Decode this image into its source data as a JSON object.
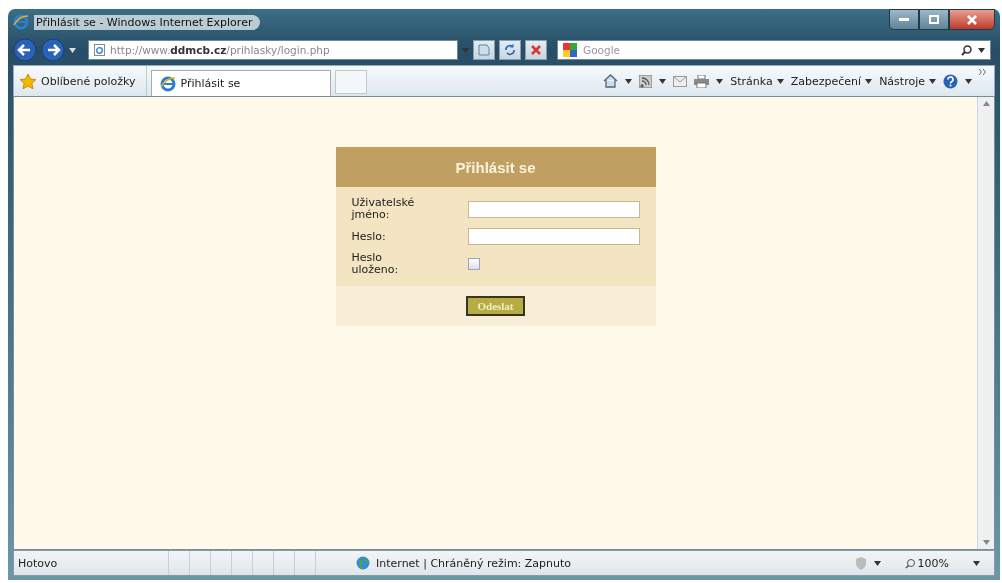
{
  "window": {
    "title": "Přihlásit se - Windows Internet Explorer"
  },
  "address_bar": {
    "url_prefix": "http://www.",
    "url_domain": "ddmcb.cz",
    "url_path": "/prihlasky/login.php"
  },
  "search": {
    "placeholder": "Google"
  },
  "favorites": {
    "label": "Oblíbené položky"
  },
  "tabs": [
    {
      "label": "Přihlásit se",
      "selected": true
    }
  ],
  "command_menus": [
    "Stránka",
    "Zabezpečení",
    "Nástroje"
  ],
  "login": {
    "title": "Přihlásit se",
    "fields": [
      {
        "kind": "text",
        "label": "Uživatelské jméno:"
      },
      {
        "kind": "password",
        "label": "Heslo:"
      },
      {
        "kind": "checkbox",
        "label": "Heslo uloženo:",
        "checked": false
      }
    ],
    "submit": "Odeslat"
  },
  "status_bar": {
    "status": "Hotovo",
    "zone": "Internet | Chráněný režim: Zapnuto",
    "zoom": "100%"
  }
}
